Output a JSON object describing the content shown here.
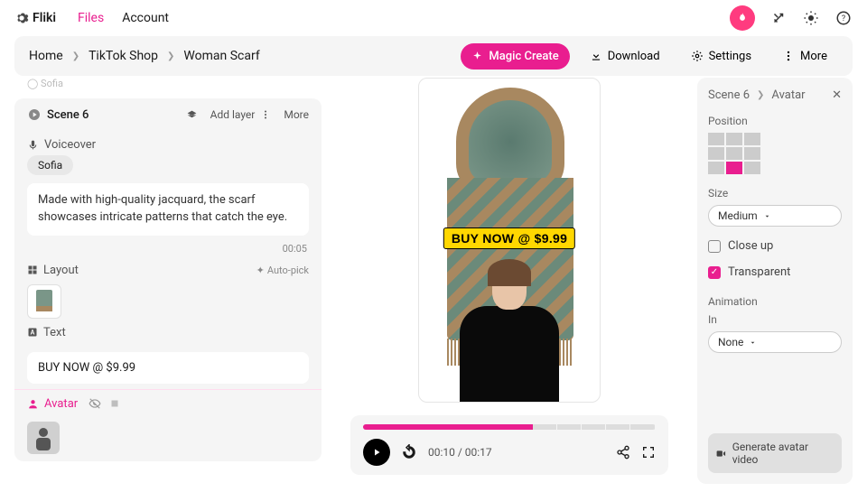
{
  "app": {
    "name": "Fliki"
  },
  "topnav": {
    "files": "Files",
    "account": "Account"
  },
  "breadcrumb": {
    "home": "Home",
    "l1": "TikTok Shop",
    "l2": "Woman Scarf"
  },
  "subbar": {
    "magic": "Magic Create",
    "download": "Download",
    "settings": "Settings",
    "more": "More"
  },
  "left": {
    "peek": "Sofia",
    "scene_title": "Scene 6",
    "add_layer": "Add layer",
    "more": "More",
    "voiceover": "Voiceover",
    "voice_chip": "Sofia",
    "voice_text": "Made with high-quality jacquard, the scarf showcases intricate patterns that catch the eye.",
    "duration": "00:05",
    "layout": "Layout",
    "auto_pick": "Auto-pick",
    "text_label": "Text",
    "text_value": "BUY NOW @ $9.99",
    "avatar_label": "Avatar"
  },
  "preview": {
    "overlay": "BUY NOW @ $9.99"
  },
  "player": {
    "time": "00:10 / 00:17",
    "progress_pct": 58,
    "segments": 12
  },
  "right": {
    "scene": "Scene 6",
    "panel": "Avatar",
    "position": "Position",
    "size_label": "Size",
    "size_value": "Medium",
    "closeup": "Close up",
    "transparent": "Transparent",
    "animation": "Animation",
    "in_label": "In",
    "in_value": "None",
    "generate": "Generate avatar video"
  }
}
